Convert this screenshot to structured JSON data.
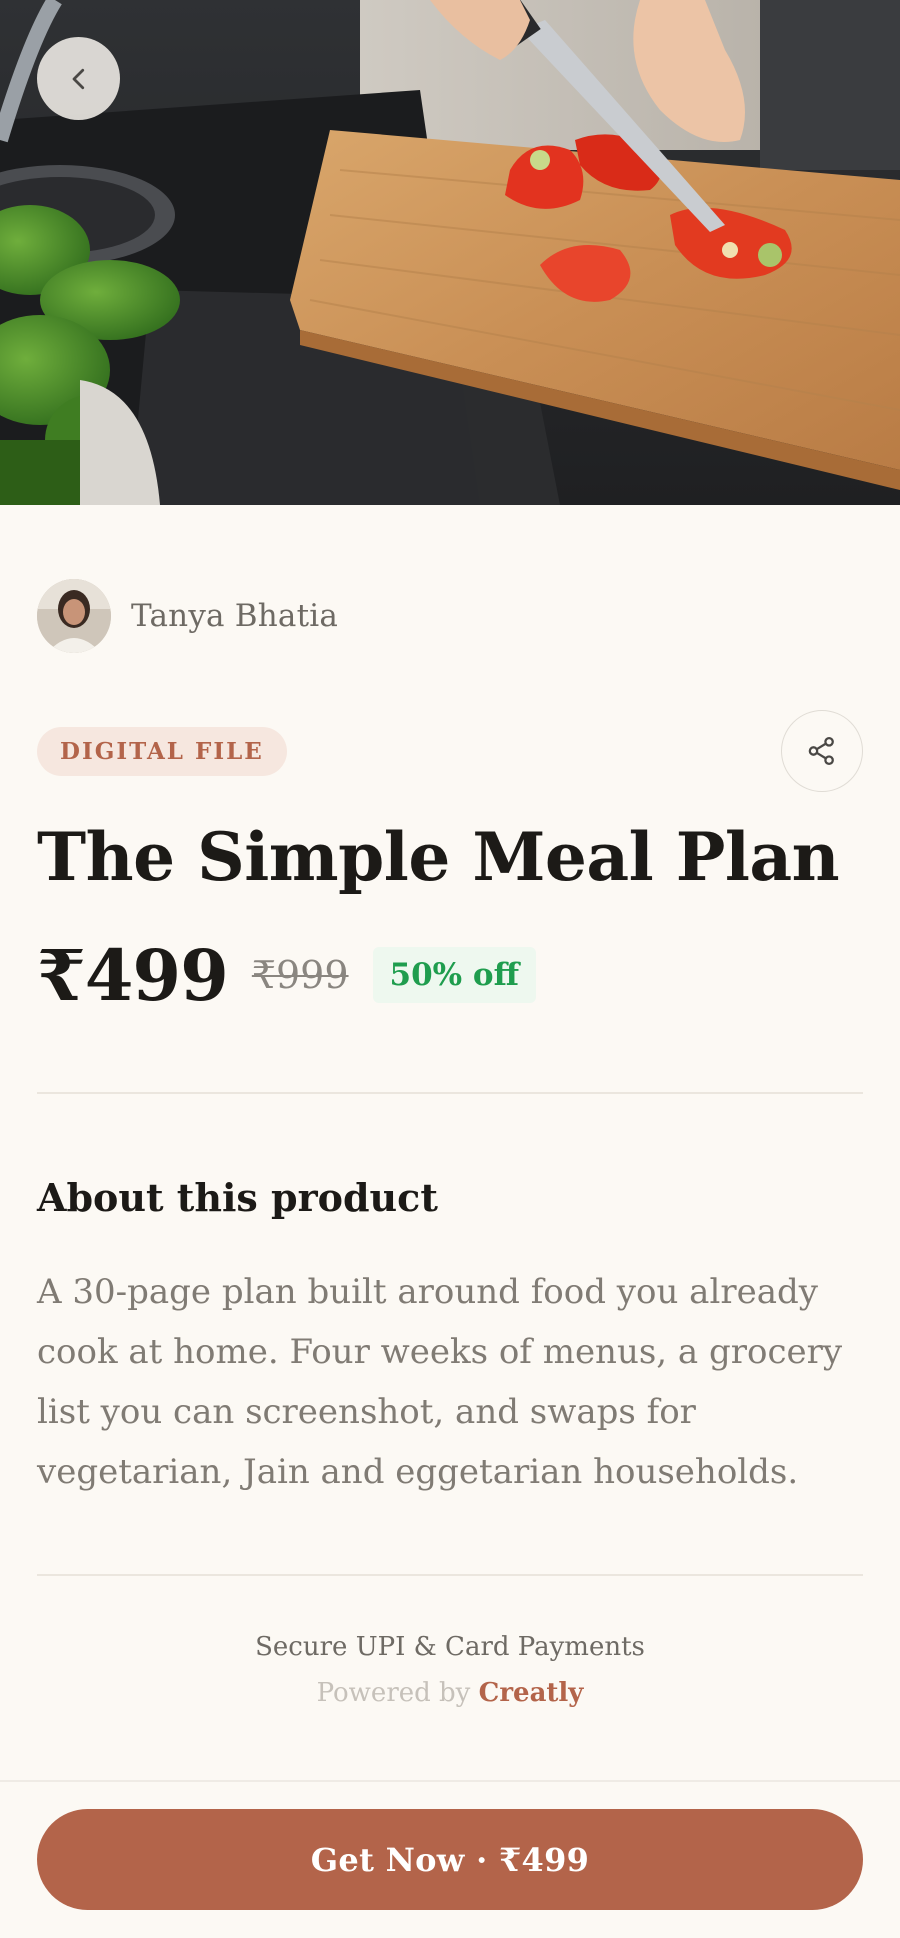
{
  "hero": {
    "image_alt_icon": "cooking-photo",
    "back_icon": "chevron-left-icon"
  },
  "creator": {
    "name": "Tanya Bhatia"
  },
  "product": {
    "type_badge": "DIGITAL FILE",
    "title": "The Simple Meal Plan",
    "price": "₹499",
    "original_price": "₹999",
    "discount": "50% off"
  },
  "share": {
    "icon": "share-icon"
  },
  "about": {
    "heading": "About this product",
    "description": "A 30-page plan built around food you already cook at home. Four weeks of menus, a grocery list you can screenshot, and swaps for vegetarian, Jain and eggetarian households."
  },
  "footer": {
    "secure_text": "Secure UPI & Card Payments",
    "powered_prefix": "Powered by",
    "powered_brand": "Creatly"
  },
  "cta": {
    "label": "Get Now · ₹499"
  },
  "colors": {
    "background": "#fcf9f4",
    "accent": "#b3644a",
    "badge_bg": "#f6e7df",
    "discount_green": "#1f9d4e",
    "discount_bg": "#eef8ef",
    "text_primary": "#1c1a17",
    "text_muted": "#807b74"
  }
}
